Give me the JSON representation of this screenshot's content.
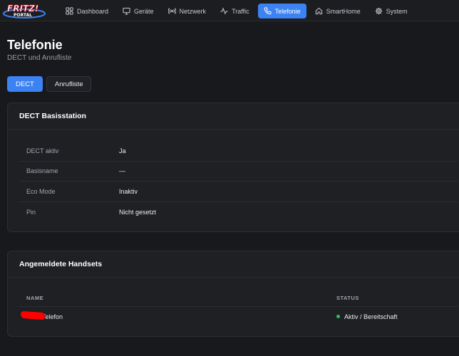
{
  "brand": {
    "logo_line1": "FRITZ!",
    "logo_line2": "PORTAL",
    "colors": {
      "primary": "#3d82f2",
      "logo_red": "#e2001a",
      "success": "#22c55e"
    }
  },
  "nav": {
    "items": [
      {
        "label": "Dashboard",
        "icon": "grid-icon"
      },
      {
        "label": "Geräte",
        "icon": "monitor-icon"
      },
      {
        "label": "Netzwerk",
        "icon": "broadcast-icon"
      },
      {
        "label": "Traffic",
        "icon": "activity-icon"
      },
      {
        "label": "Telefonie",
        "icon": "phone-icon",
        "active": true
      },
      {
        "label": "SmartHome",
        "icon": "home-icon"
      },
      {
        "label": "System",
        "icon": "gear-icon"
      }
    ]
  },
  "page": {
    "title": "Telefonie",
    "subtitle": "DECT und Anrufliste"
  },
  "tabs": [
    {
      "label": "DECT",
      "active": true
    },
    {
      "label": "Anrufliste",
      "active": false
    }
  ],
  "dect": {
    "title": "DECT Basisstation",
    "rows": [
      {
        "label": "DECT aktiv",
        "value": "Ja"
      },
      {
        "label": "Basisname",
        "value": "—"
      },
      {
        "label": "Eco Mode",
        "value": "Inaktiv"
      },
      {
        "label": "Pin",
        "value": "Nicht gesetzt"
      }
    ]
  },
  "handsets": {
    "title": "Angemeldete Handsets",
    "columns": {
      "name": "NAME",
      "status": "STATUS"
    },
    "rows": [
      {
        "name": "Telefon",
        "status": "Aktiv / Bereitschaft"
      }
    ]
  }
}
